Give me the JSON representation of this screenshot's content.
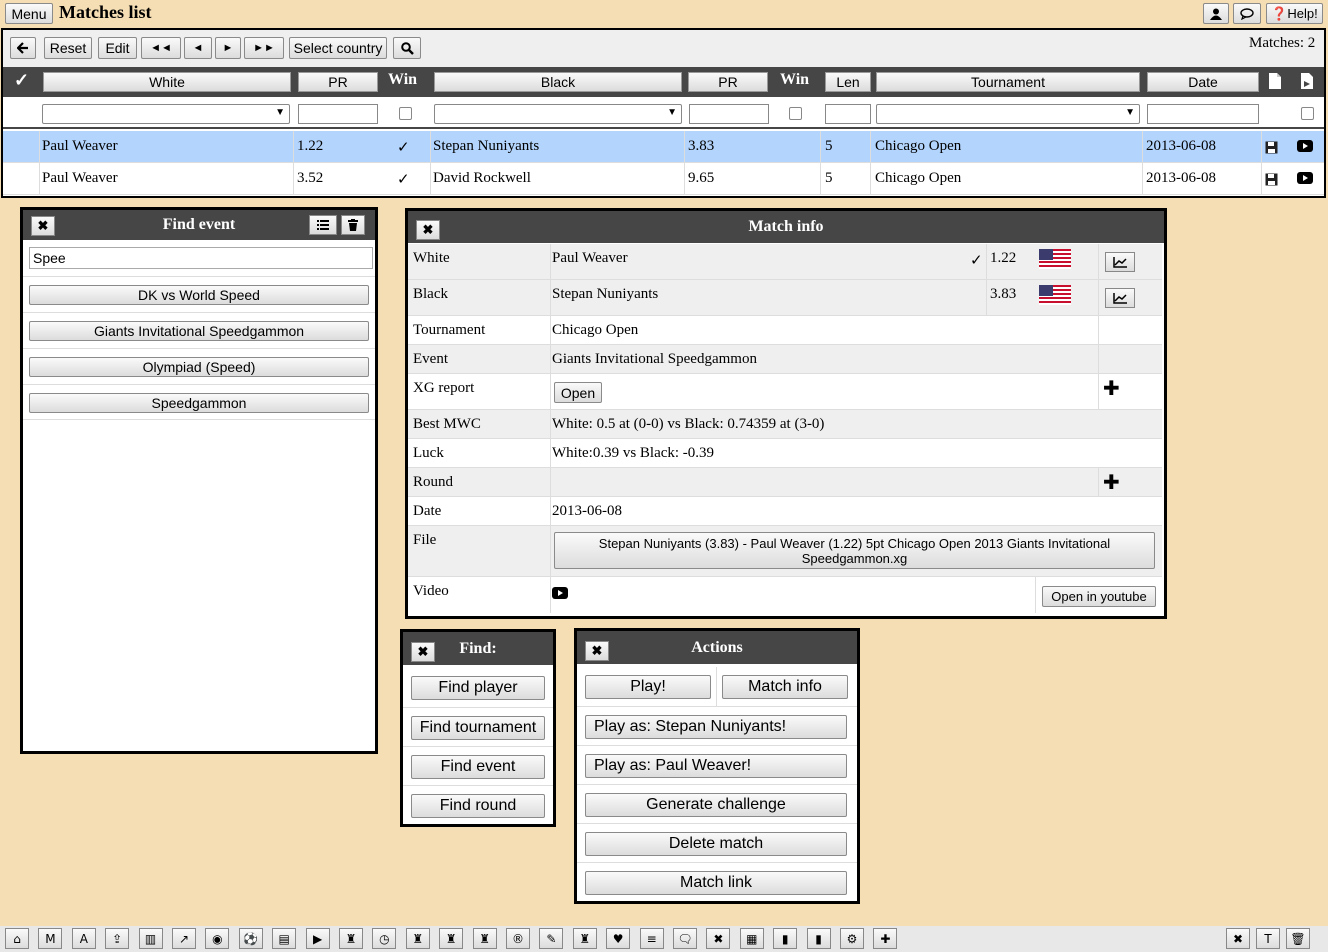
{
  "topbar": {
    "menu_label": "Menu",
    "title": "Matches list",
    "user_icon": "👤",
    "chat_icon": "🗨",
    "help_label": "❓Help!"
  },
  "toolbar": {
    "back": "🡐",
    "reset": "Reset",
    "edit": "Edit",
    "first": "◄◄",
    "prev": "◄",
    "next": "►",
    "last": "►►",
    "select_country": "Select country",
    "search": "🔍",
    "matches_count": "Matches: 2"
  },
  "columns": {
    "check": "✓",
    "white": "White",
    "pr1": "PR",
    "win1": "Win",
    "black": "Black",
    "pr2": "PR",
    "win2": "Win",
    "len": "Len",
    "tournament": "Tournament",
    "date": "Date"
  },
  "rows": [
    {
      "white": "Paul Weaver",
      "pr1": "1.22",
      "win": "✓",
      "black": "Stepan Nuniyants",
      "pr2": "3.83",
      "len": "5",
      "tournament": "Chicago Open",
      "date": "2013-06-08"
    },
    {
      "white": "Paul Weaver",
      "pr1": "3.52",
      "win": "✓",
      "black": "David Rockwell",
      "pr2": "9.65",
      "len": "5",
      "tournament": "Chicago Open",
      "date": "2013-06-08"
    }
  ],
  "find_event": {
    "title": "Find event",
    "search_value": "Spee",
    "results": [
      "DK vs World Speed",
      "Giants Invitational Speedgammon",
      "Olympiad (Speed)",
      "Speedgammon"
    ]
  },
  "match_info": {
    "title": "Match info",
    "white_label": "White",
    "white_name": "Paul Weaver",
    "white_win": "✓",
    "white_pr": "1.22",
    "black_label": "Black",
    "black_name": "Stepan Nuniyants",
    "black_pr": "3.83",
    "tournament_label": "Tournament",
    "tournament": "Chicago Open",
    "event_label": "Event",
    "event": "Giants Invitational Speedgammon",
    "xg_label": "XG report",
    "xg_button": "Open",
    "mwc_label": "Best MWC",
    "mwc": "White: 0.5 at (0-0) vs Black: 0.74359 at (3-0)",
    "luck_label": "Luck",
    "luck": "White:0.39 vs Black: -0.39",
    "round_label": "Round",
    "round": "",
    "date_label": "Date",
    "date": "2013-06-08",
    "file_label": "File",
    "file": "Stepan Nuniyants (3.83) - Paul Weaver (1.22) 5pt Chicago Open 2013 Giants Invitational Speedgammon.xg",
    "video_label": "Video",
    "youtube_button": "Open in youtube"
  },
  "find": {
    "title": "Find:",
    "items": [
      "Find player",
      "Find tournament",
      "Find event",
      "Find round"
    ]
  },
  "actions": {
    "title": "Actions",
    "play": "Play!",
    "match_info": "Match info",
    "play_as_black": "Play as: Stepan Nuniyants!",
    "play_as_white": "Play as: Paul Weaver!",
    "challenge": "Generate challenge",
    "delete": "Delete match",
    "link": "Match link"
  },
  "footer": {
    "icons": [
      "home-icon",
      "m-icon",
      "a-icon",
      "upload-icon",
      "bar-chart-icon",
      "line-chart-icon",
      "eye-icon",
      "ball-icon",
      "archive-icon",
      "play-icon",
      "trophy-icon",
      "clock-icon",
      "trophy-icon",
      "trophy-icon",
      "trophy-icon",
      "registered-icon",
      "edit-icon",
      "trophy-icon",
      "heart-icon",
      "database-icon",
      "chat-icon",
      "close-icon",
      "film-icon",
      "bookmark-icon",
      "bookmark-icon",
      "gears-icon",
      "plus-icon"
    ],
    "glyphs": [
      "⌂",
      "M",
      "A",
      "⇪",
      "▥",
      "↗",
      "◉",
      "⚽",
      "▤",
      "▶",
      "♜",
      "◷",
      "♜",
      "♜",
      "♜",
      "®",
      "✎",
      "♜",
      "♥",
      "≡",
      "🗨",
      "✖",
      "▦",
      "▮",
      "▮",
      "⚙",
      "✚"
    ],
    "right_glyphs": [
      "✖",
      "T",
      "🗑"
    ]
  }
}
